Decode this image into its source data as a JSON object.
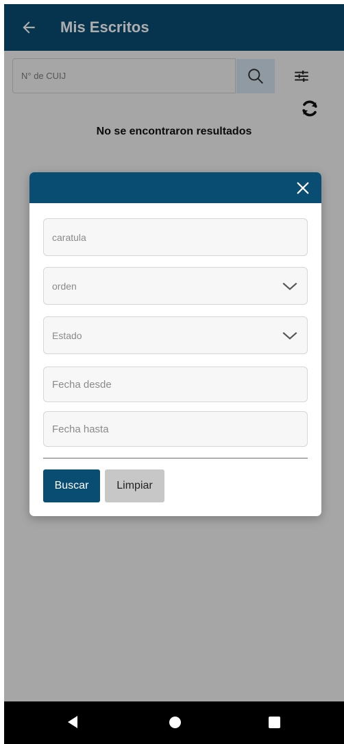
{
  "appbar": {
    "title": "Mis Escritos",
    "back_icon": "arrow-left-icon"
  },
  "search": {
    "placeholder": "N° de CUIJ",
    "value": "",
    "search_icon": "magnify-icon",
    "filter_icon": "sliders-icon",
    "refresh_icon": "refresh-icon"
  },
  "results": {
    "empty_message": "No se encontraron resultados"
  },
  "filter_dialog": {
    "close_icon": "close-icon",
    "caratula_placeholder": "caratula",
    "orden_placeholder": "orden",
    "estado_placeholder": "Estado",
    "fecha_desde_placeholder": "Fecha desde",
    "fecha_hasta_placeholder": "Fecha hasta",
    "search_button": "Buscar",
    "clear_button": "Limpiar"
  },
  "colors": {
    "primary": "#0a4d73",
    "search_button_bg": "#d3e4ef",
    "clear_button_bg": "#c7c7c7",
    "navbar": "#000000"
  },
  "navbar": {
    "back_icon": "triangle-back-icon",
    "home_icon": "circle-home-icon",
    "recents_icon": "square-recents-icon"
  }
}
